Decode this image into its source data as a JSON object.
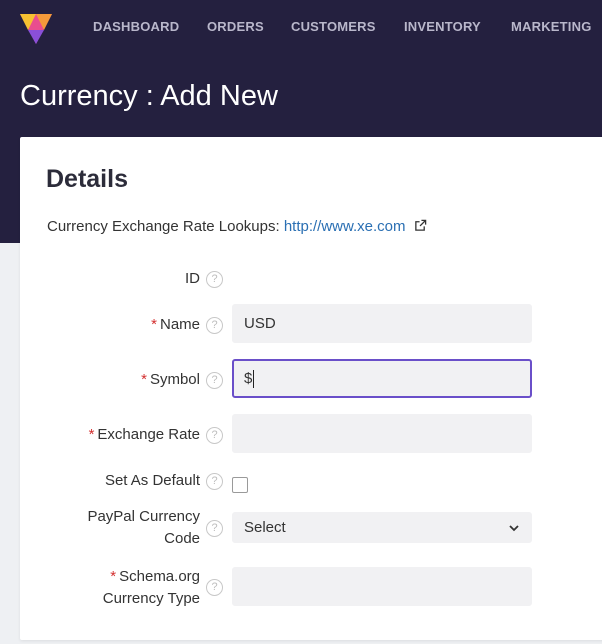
{
  "nav": {
    "items": [
      "DASHBOARD",
      "ORDERS",
      "CUSTOMERS",
      "INVENTORY",
      "MARKETING"
    ]
  },
  "page": {
    "title": "Currency : Add New"
  },
  "card": {
    "section_title": "Details",
    "lookup_label": "Currency Exchange Rate Lookups:",
    "lookup_link": "http://www.xe.com"
  },
  "form": {
    "id_label": "ID",
    "name_label": "Name",
    "name_value": "USD",
    "symbol_label": "Symbol",
    "symbol_value": "$",
    "exchange_rate_label": "Exchange Rate",
    "exchange_rate_value": "",
    "set_default_label": "Set As Default",
    "paypal_label_line1": "PayPal Currency",
    "paypal_label_line2": "Code",
    "paypal_selected": "Select",
    "schema_label_line1": "Schema.org",
    "schema_label_line2": "Currency Type",
    "schema_value": "",
    "required_marker": "*",
    "help_glyph": "?"
  },
  "colors": {
    "header_bg": "#24203f",
    "accent": "#6a4fc9",
    "link": "#2a6fb3",
    "required": "#d32f2f"
  },
  "icons": [
    "logo-icon",
    "help-icon",
    "external-link-icon",
    "chevron-down-icon"
  ]
}
